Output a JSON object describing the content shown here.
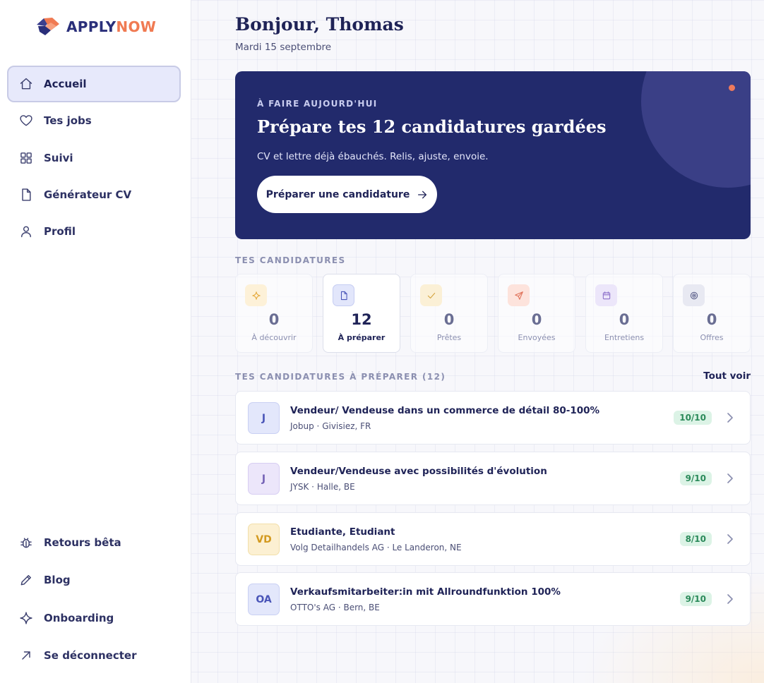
{
  "brand": {
    "part1": "APPLY",
    "part2": "NOW"
  },
  "nav": {
    "top": [
      {
        "id": "accueil",
        "label": "Accueil",
        "icon": "home-icon",
        "active": true
      },
      {
        "id": "tes-jobs",
        "label": "Tes jobs",
        "icon": "heart-icon"
      },
      {
        "id": "suivi",
        "label": "Suivi",
        "icon": "grid-icon"
      },
      {
        "id": "generateur-cv",
        "label": "Générateur CV",
        "icon": "document-icon"
      },
      {
        "id": "profil",
        "label": "Profil",
        "icon": "user-icon"
      }
    ],
    "bottom": [
      {
        "id": "retours-beta",
        "label": "Retours bêta",
        "icon": "bug-icon"
      },
      {
        "id": "blog",
        "label": "Blog",
        "icon": "pencil-icon"
      },
      {
        "id": "onboarding",
        "label": "Onboarding",
        "icon": "sparkle-icon"
      },
      {
        "id": "se-deconnecter",
        "label": "Se déconnecter",
        "icon": "arrow-up-right-icon"
      }
    ]
  },
  "header": {
    "greeting": "Bonjour, Thomas",
    "date": "Mardi 15 septembre"
  },
  "hero": {
    "eyebrow": "À FAIRE AUJOURD'HUI",
    "title": "Prépare tes 12 candidatures gardées",
    "subtitle": "CV et lettre déjà ébauchés. Relis, ajuste, envoie.",
    "cta": "Préparer une candidature"
  },
  "stats": {
    "section_label": "TES CANDIDATURES",
    "items": [
      {
        "value": "0",
        "label": "À découvrir",
        "icon": "sparkle-icon",
        "color": "#e5a93a",
        "bg": "#fdf1d8"
      },
      {
        "value": "12",
        "label": "À préparer",
        "icon": "document-icon",
        "color": "#4a55b8",
        "bg": "#e2e6fb",
        "active": true
      },
      {
        "value": "0",
        "label": "Prêtes",
        "icon": "check-icon",
        "color": "#d4a23c",
        "bg": "#fbf0d6"
      },
      {
        "value": "0",
        "label": "Envoyées",
        "icon": "send-icon",
        "color": "#e0735b",
        "bg": "#fde3dc"
      },
      {
        "value": "0",
        "label": "Entretiens",
        "icon": "calendar-icon",
        "color": "#8b6fc9",
        "bg": "#ece6fa"
      },
      {
        "value": "0",
        "label": "Offres",
        "icon": "target-icon",
        "color": "#5b5f8a",
        "bg": "#e8e9f2"
      }
    ]
  },
  "jobs": {
    "section_label": "TES CANDIDATURES À PRÉPARER (12)",
    "see_all": "Tout voir",
    "items": [
      {
        "initials": "J",
        "title": "Vendeur/ Vendeuse dans un commerce de détail 80-100%",
        "company": "Jobup",
        "location": "Givisiez, FR",
        "score": "10/10",
        "avatar_bg": "#e3e7fb",
        "avatar_color": "#4a55b8"
      },
      {
        "initials": "J",
        "title": "Vendeur/Vendeuse avec possibilités d'évolution",
        "company": "JYSK",
        "location": "Halle, BE",
        "score": "9/10",
        "avatar_bg": "#ece6fa",
        "avatar_color": "#7462b5"
      },
      {
        "initials": "VD",
        "title": "Etudiante, Etudiant",
        "company": "Volg Detailhandels AG",
        "location": "Le Landeron, NE",
        "score": "8/10",
        "avatar_bg": "#fcf0d2",
        "avatar_color": "#d39a1f"
      },
      {
        "initials": "OA",
        "title": "Verkaufsmitarbeiter:in mit Allroundfunktion 100%",
        "company": "OTTO's AG",
        "location": "Bern, BE",
        "score": "9/10",
        "avatar_bg": "#e3e7fb",
        "avatar_color": "#4a55b8"
      }
    ]
  }
}
